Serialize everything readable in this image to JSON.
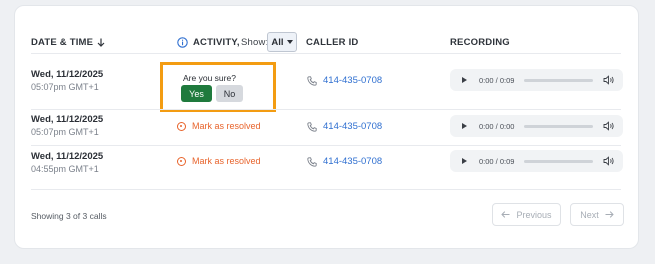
{
  "header": {
    "date_time": "DATE & TIME",
    "activity": "ACTIVITY,",
    "show_label": "Show:",
    "show_value": "All",
    "caller_id": "CALLER ID",
    "recording": "RECORDING"
  },
  "confirm": {
    "question": "Are you sure?",
    "yes": "Yes",
    "no": "No"
  },
  "rows": [
    {
      "date": "Wed, 11/12/2025",
      "time": "05:07pm GMT+1",
      "activity": "",
      "caller": "414-435-0708",
      "player_time": "0:00 / 0:09"
    },
    {
      "date": "Wed, 11/12/2025",
      "time": "05:07pm GMT+1",
      "activity": "Mark as resolved",
      "caller": "414-435-0708",
      "player_time": "0:00 / 0:00"
    },
    {
      "date": "Wed, 11/12/2025",
      "time": "04:55pm GMT+1",
      "activity": "Mark as resolved",
      "caller": "414-435-0708",
      "player_time": "0:00 / 0:09"
    }
  ],
  "footer": {
    "showing": "Showing 3 of 3 calls",
    "previous": "Previous",
    "next": "Next"
  },
  "colors": {
    "accent_orange": "#e8642c",
    "highlight": "#f39c12",
    "link_blue": "#2f6fd0",
    "yes_green": "#1f7a3d"
  }
}
